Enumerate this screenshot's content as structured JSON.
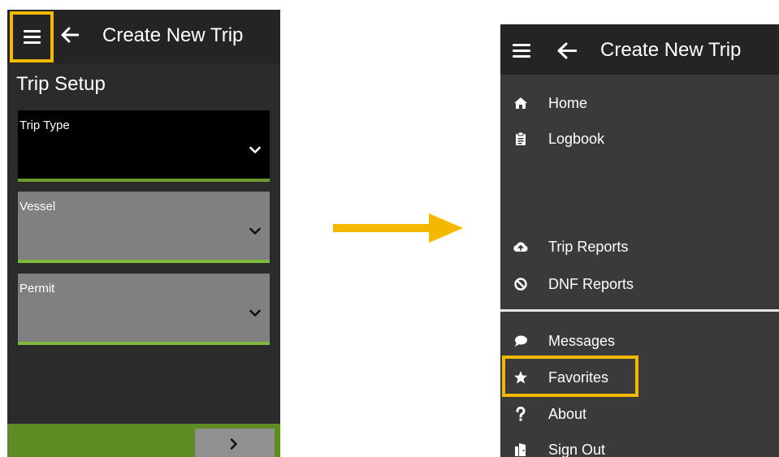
{
  "left_screen": {
    "header": {
      "title": "Create New Trip",
      "menu_icon": "hamburger-icon",
      "back_icon": "arrow-left-icon"
    },
    "section_title": "Trip Setup",
    "fields": [
      {
        "label": "Trip Type",
        "value": "",
        "state": "focused"
      },
      {
        "label": "Vessel",
        "value": "",
        "state": "inactive"
      },
      {
        "label": "Permit",
        "value": "",
        "state": "inactive"
      }
    ],
    "footer": {
      "next_icon": "chevron-right-icon"
    }
  },
  "right_screen": {
    "header": {
      "title": "Create New Trip",
      "menu_icon": "hamburger-icon",
      "back_icon": "arrow-left-icon"
    },
    "menu": {
      "group1": [
        {
          "label": "Home",
          "icon": "home-icon"
        },
        {
          "label": "Logbook",
          "icon": "clipboard-icon"
        }
      ],
      "group2": [
        {
          "label": "Trip Reports",
          "icon": "cloud-upload-icon"
        },
        {
          "label": "DNF Reports",
          "icon": "ban-icon"
        }
      ],
      "group3": [
        {
          "label": "Messages",
          "icon": "speech-bubble-icon"
        },
        {
          "label": "Favorites",
          "icon": "star-icon",
          "highlighted": true
        },
        {
          "label": "About",
          "icon": "question-icon"
        },
        {
          "label": "Sign Out",
          "icon": "door-exit-icon"
        }
      ]
    }
  },
  "colors": {
    "highlight": "#f5b800",
    "field_underline": "#6d9b2f",
    "footer_green": "#5f8b24",
    "arrow": "#f5b800"
  }
}
